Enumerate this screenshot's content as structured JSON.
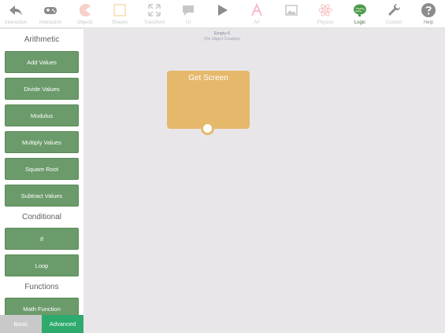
{
  "toolbar": {
    "items": [
      {
        "label": "Interaction",
        "icon": "back-arrow-icon"
      },
      {
        "label": "Interaction",
        "icon": "gamepad-icon"
      },
      {
        "label": "Objects",
        "icon": "pacman-icon"
      },
      {
        "label": "Shapes",
        "icon": "square-icon"
      },
      {
        "label": "Transform",
        "icon": "expand-icon"
      },
      {
        "label": "UI",
        "icon": "speech-bubble-icon"
      },
      {
        "label": "",
        "icon": "play-icon"
      },
      {
        "label": "Art",
        "icon": "art-icon"
      },
      {
        "label": "",
        "icon": "image-icon"
      },
      {
        "label": "Physics",
        "icon": "atom-icon"
      },
      {
        "label": "Logic",
        "icon": "brain-icon"
      },
      {
        "label": "Custom",
        "icon": "wrench-icon"
      },
      {
        "label": "Help",
        "icon": "help-icon"
      }
    ]
  },
  "sidebar": {
    "sections": {
      "arithmetic": "Arithmetic",
      "conditional": "Conditional",
      "functions": "Functions"
    },
    "blocks": {
      "add_values": "Add Values",
      "divide_values": "Divide Values",
      "modulus": "Modulus",
      "multiply_values": "Multiply Values",
      "square_root": "Square Root",
      "subtract_values": "Subtract Values",
      "if": "If",
      "loop": "Loop",
      "math_function": "Math Function"
    },
    "mode": {
      "basic": "Basic",
      "advanced": "Advanced",
      "selected": "Advanced"
    }
  },
  "canvas": {
    "title": "Empty-6",
    "subtitle": "(On Object Creation)",
    "block": {
      "label": "Get Screen"
    }
  },
  "colors": {
    "block_green": "#6b9b6a",
    "block_orange": "#e6b86c",
    "advanced_green": "#2eaa6e",
    "basic_gray": "#c9c9c9"
  }
}
